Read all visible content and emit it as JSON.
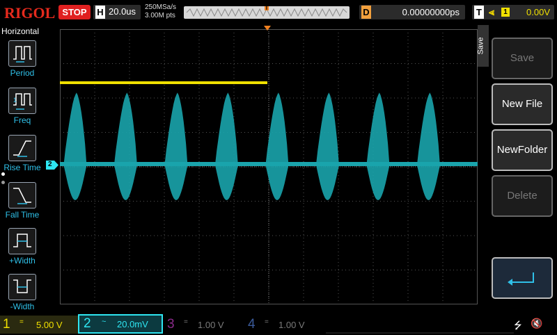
{
  "header": {
    "brand": "RIGOL",
    "run_state": "STOP",
    "timebase_key": "H",
    "timebase_value": "20.0us",
    "sample_rate": "250MSa/s",
    "memory_depth": "3.00M pts",
    "trigger_position_marker": "T",
    "delay_key": "D",
    "delay_value": "0.00000000ps",
    "trigger_key": "T",
    "trigger_source": "1",
    "trigger_level": "0.00V",
    "trigger_edge_icon": "rising-edge-icon"
  },
  "measure_panel": {
    "title": "Horizontal",
    "items": [
      {
        "label": "Period",
        "icon": "period-icon"
      },
      {
        "label": "Freq",
        "icon": "frequency-icon"
      },
      {
        "label": "Rise Time",
        "icon": "rise-time-icon"
      },
      {
        "label": "Fall Time",
        "icon": "fall-time-icon"
      },
      {
        "label": "+Width",
        "icon": "positive-width-icon"
      },
      {
        "label": "-Width",
        "icon": "negative-width-icon"
      }
    ]
  },
  "softkeys": {
    "menu_title": "Save",
    "items": [
      {
        "label": "Save",
        "enabled": false
      },
      {
        "label": "New File",
        "enabled": true
      },
      {
        "label": "NewFolder",
        "enabled": true
      },
      {
        "label": "Delete",
        "enabled": false
      },
      {
        "label": "",
        "enabled": true,
        "icon": "return-arrow-icon"
      }
    ]
  },
  "screen": {
    "ch2_marker": "2",
    "trigger_level_marker": "T",
    "bursts": 8,
    "colors": {
      "ch1": "#f0e000",
      "ch2": "#2ee6f2",
      "ch2_trace": "#1aa4ac",
      "grid": "#555555"
    }
  },
  "channels": [
    {
      "num": "1",
      "coupling": "=",
      "scale": "5.00 V",
      "active": true
    },
    {
      "num": "2",
      "coupling": "~",
      "scale": "20.0mV",
      "active": true
    },
    {
      "num": "3",
      "coupling": "=",
      "scale": "1.00 V",
      "active": false
    },
    {
      "num": "4",
      "coupling": "=",
      "scale": "1.00 V",
      "active": false
    }
  ],
  "status_icons": [
    "usb-icon",
    "speaker-muted-icon"
  ]
}
